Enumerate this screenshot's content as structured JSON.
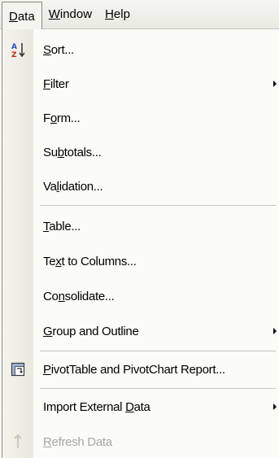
{
  "menubar": {
    "items": [
      {
        "label_pre": "",
        "mnemonic": "D",
        "label_post": "ata"
      },
      {
        "label_pre": "",
        "mnemonic": "W",
        "label_post": "indow"
      },
      {
        "label_pre": "",
        "mnemonic": "H",
        "label_post": "elp"
      }
    ]
  },
  "menu": {
    "items": [
      {
        "pre": "",
        "mn": "S",
        "post": "ort...",
        "icon": "sort-az-icon",
        "submenu": false,
        "enabled": true
      },
      {
        "pre": "",
        "mn": "F",
        "post": "ilter",
        "icon": null,
        "submenu": true,
        "enabled": true
      },
      {
        "pre": "F",
        "mn": "o",
        "post": "rm...",
        "icon": null,
        "submenu": false,
        "enabled": true
      },
      {
        "pre": "Su",
        "mn": "b",
        "post": "totals...",
        "icon": null,
        "submenu": false,
        "enabled": true
      },
      {
        "pre": "Va",
        "mn": "l",
        "post": "idation...",
        "icon": null,
        "submenu": false,
        "enabled": true
      },
      {
        "pre": "",
        "mn": "T",
        "post": "able...",
        "icon": null,
        "submenu": false,
        "enabled": true
      },
      {
        "pre": "Te",
        "mn": "x",
        "post": "t to Columns...",
        "icon": null,
        "submenu": false,
        "enabled": true
      },
      {
        "pre": "Co",
        "mn": "n",
        "post": "solidate...",
        "icon": null,
        "submenu": false,
        "enabled": true
      },
      {
        "pre": "",
        "mn": "G",
        "post": "roup and Outline",
        "icon": null,
        "submenu": true,
        "enabled": true
      },
      {
        "pre": "",
        "mn": "P",
        "post": "ivotTable and PivotChart Report...",
        "icon": "pivottable-icon",
        "submenu": false,
        "enabled": true
      },
      {
        "pre": "Import External ",
        "mn": "D",
        "post": "ata",
        "icon": null,
        "submenu": true,
        "enabled": true
      },
      {
        "pre": "",
        "mn": "R",
        "post": "efresh Data",
        "icon": "refresh-icon",
        "submenu": false,
        "enabled": false
      }
    ]
  }
}
